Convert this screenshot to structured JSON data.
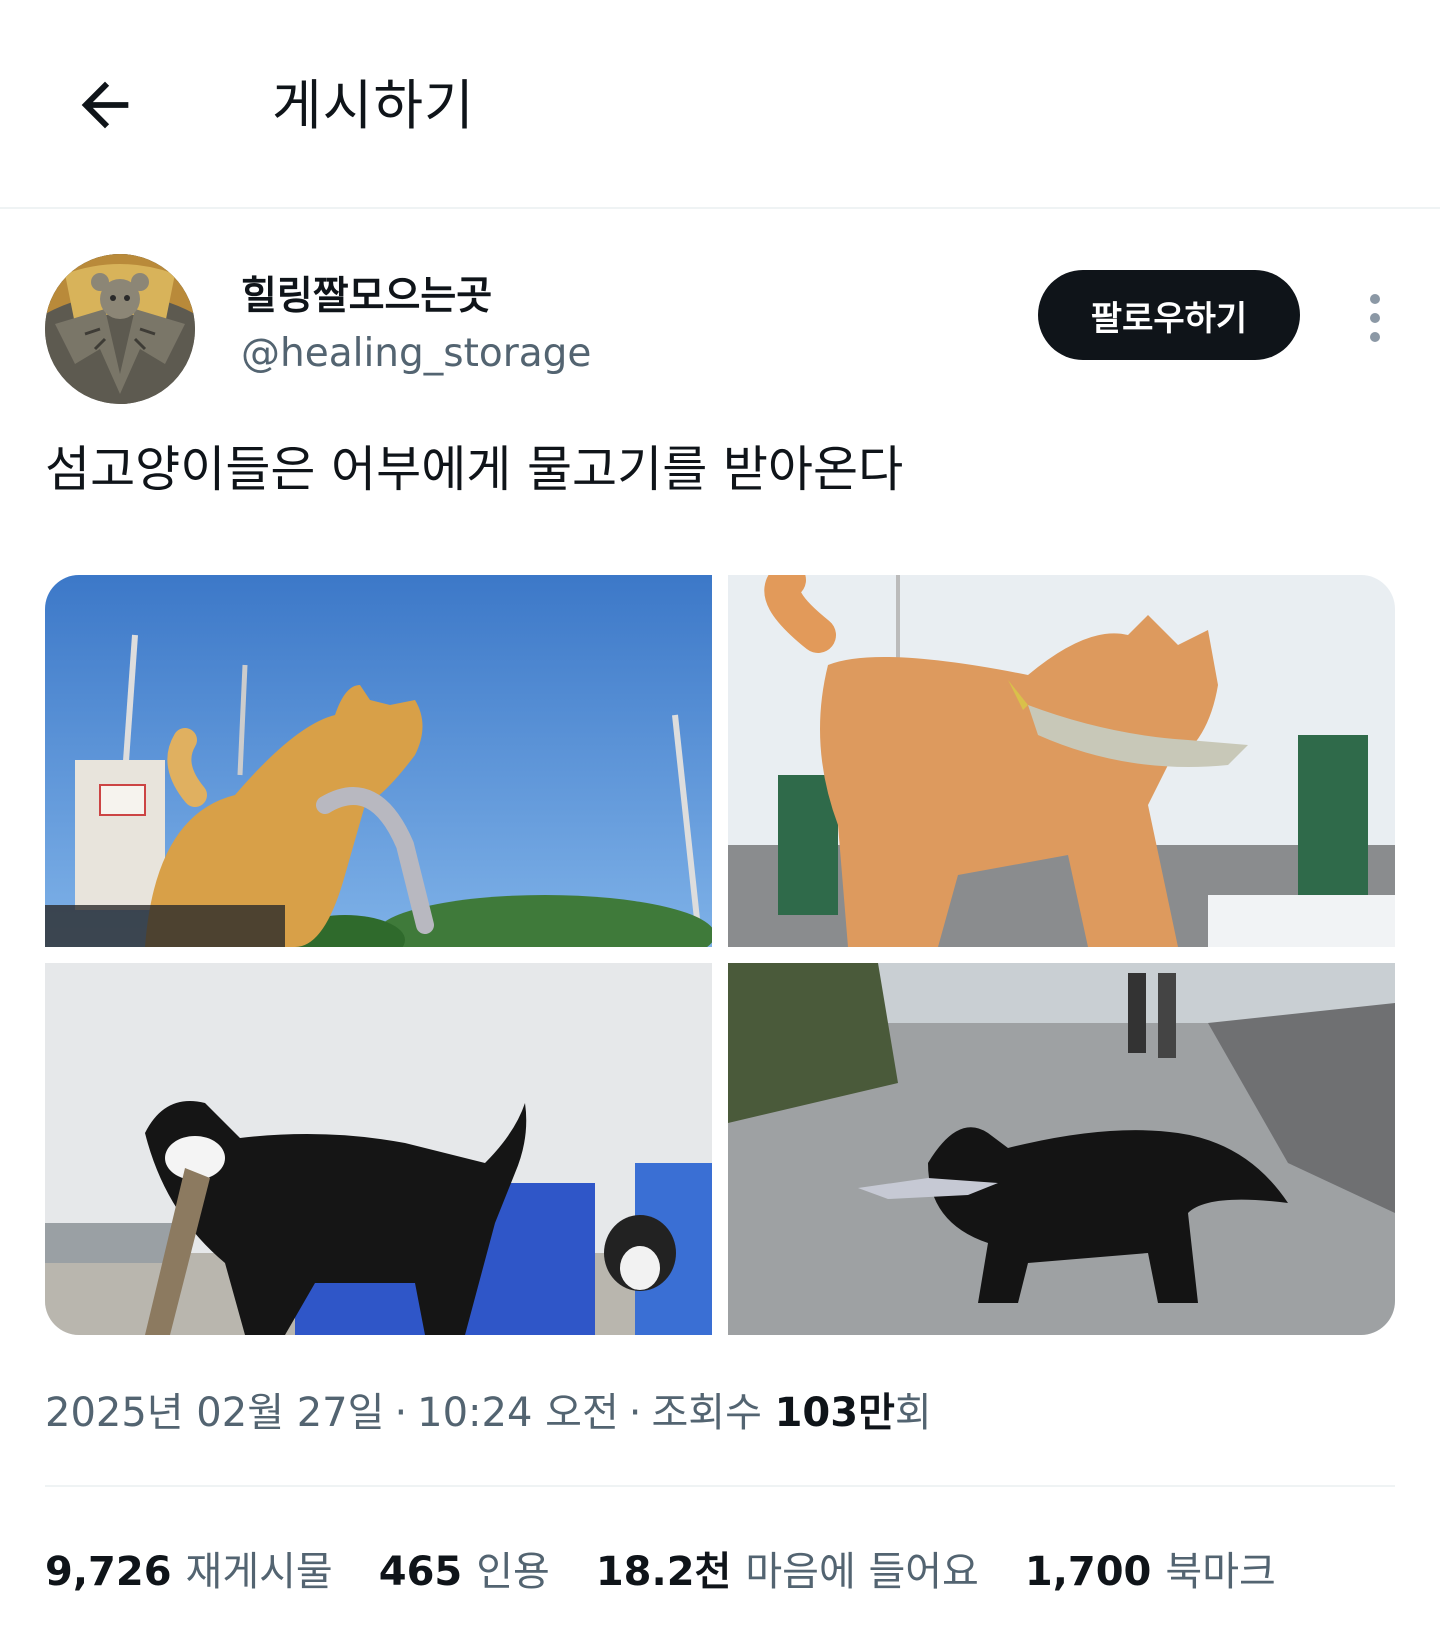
{
  "header": {
    "back_icon": "arrow-left-icon",
    "title": "게시하기"
  },
  "author": {
    "display_name": "힐링짤모으는곳",
    "handle": "@healing_storage",
    "follow_label": "팔로우하기",
    "more_icon": "more-vertical-icon"
  },
  "post": {
    "text": "섬고양이들은 어부에게 물고기를 받아온다"
  },
  "meta": {
    "date": "2025년 02월 27일",
    "sep1": "·",
    "time": "10:24 오전",
    "sep2": "·",
    "views_label": "조회수",
    "views_value": "103만",
    "views_suffix": "회"
  },
  "stats": [
    {
      "value": "9,726",
      "label": "재게시물"
    },
    {
      "value": "465",
      "label": "인용"
    },
    {
      "value": "18.2천",
      "label": "마음에 들어요"
    },
    {
      "value": "1,700",
      "label": "북마크"
    }
  ],
  "colors": {
    "text": "#0f1419",
    "secondary": "#536471",
    "follow_bg": "#0f1419",
    "divider": "#eff3f4"
  }
}
